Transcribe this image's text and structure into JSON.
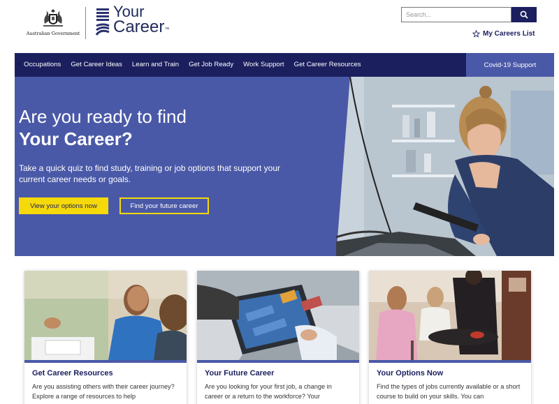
{
  "header": {
    "gov_text": "Australian Government",
    "logo_line1": "Your",
    "logo_line2": "Career",
    "logo_tm": "™",
    "search_placeholder": "Search...",
    "search_icon": "magnifier-icon",
    "careers_list_label": "My Careers List",
    "careers_list_icon": "star-outline-icon"
  },
  "nav": {
    "items": [
      "Occupations",
      "Get Career Ideas",
      "Learn and Train",
      "Get Job Ready",
      "Work Support",
      "Get Career Resources"
    ],
    "covid_label": "Covid-19 Support"
  },
  "hero": {
    "title_line1": "Are you ready to find",
    "title_line2": "Your Career?",
    "description": "Take a quick quiz to find study, training or job options that support your current career needs or goals.",
    "primary_button": "View your options now",
    "secondary_button": "Find your future career"
  },
  "cards": [
    {
      "title": "Get Career Resources",
      "description": "Are you assisting others with their career journey? Explore a range of resources to help"
    },
    {
      "title": "Your Future Career",
      "description": "Are you looking for your first job, a change in career or a return to the workforce? Your"
    },
    {
      "title": "Your Options Now",
      "description": "Find the types of jobs currently available or a short course to build on your skills. You can"
    }
  ],
  "colors": {
    "navy": "#1b1f5e",
    "hero_blue": "#4a59a7",
    "accent_yellow": "#f5d90a"
  }
}
